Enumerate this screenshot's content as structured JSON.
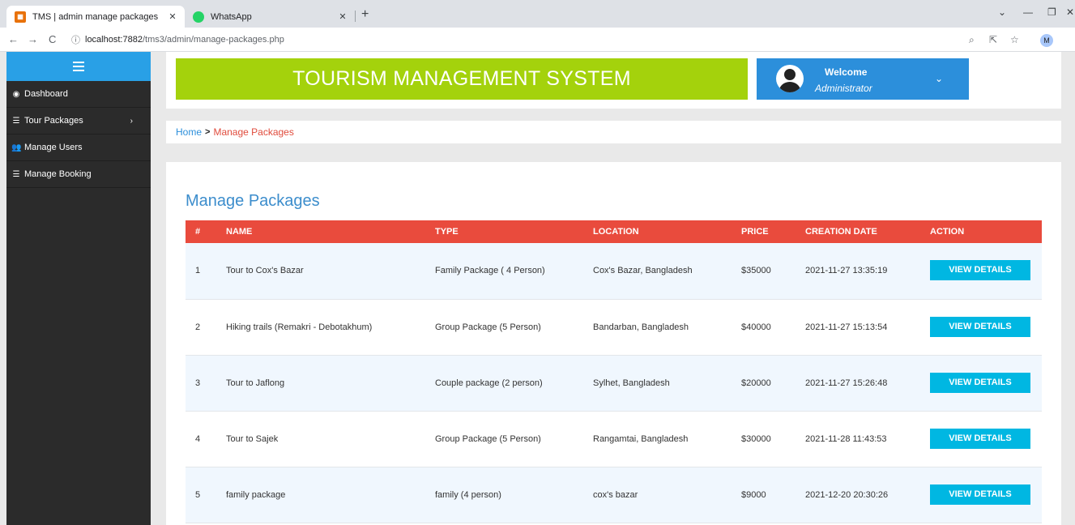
{
  "browser": {
    "tabs": [
      {
        "title": "TMS | admin manage packages",
        "close": "✕",
        "favicon": "tms-favicon"
      },
      {
        "title": "WhatsApp",
        "close": "✕",
        "favicon": "whatsapp-favicon"
      }
    ],
    "new_tab": "+",
    "window_controls": {
      "dropdown": "⌄",
      "minimize": "—",
      "restore": "❐",
      "close": "✕"
    },
    "nav": {
      "back": "←",
      "forward": "→",
      "reload": "C"
    },
    "url_host": "localhost:7882",
    "url_path": "/tms3/admin/manage-packages.php",
    "profile_initial": "M"
  },
  "sidebar": {
    "items": [
      {
        "label": "Dashboard",
        "icon": "dashboard-icon"
      },
      {
        "label": "Tour Packages",
        "icon": "list-icon"
      },
      {
        "label": "Manage Users",
        "icon": "users-icon"
      },
      {
        "label": "Manage Booking",
        "icon": "list-icon"
      }
    ]
  },
  "header": {
    "title": "TOURISM MANAGEMENT SYSTEM",
    "welcome": "Welcome",
    "user": "Administrator"
  },
  "breadcrumb": {
    "home": "Home",
    "separator": ">",
    "current": "Manage Packages"
  },
  "main": {
    "title": "Manage Packages",
    "columns": [
      "#",
      "NAME",
      "TYPE",
      "LOCATION",
      "PRICE",
      "CREATION DATE",
      "ACTION"
    ],
    "rows": [
      {
        "num": "1",
        "name": "Tour to Cox's Bazar",
        "type": "Family Package ( 4 Person)",
        "location": "Cox's Bazar, Bangladesh",
        "price": "$35000",
        "date": "2021-11-27 13:35:19",
        "action": "VIEW DETAILS"
      },
      {
        "num": "2",
        "name": "Hiking trails (Remakri - Debotakhum)",
        "type": "Group Package (5 Person)",
        "location": "Bandarban, Bangladesh",
        "price": "$40000",
        "date": "2021-11-27 15:13:54",
        "action": "VIEW DETAILS"
      },
      {
        "num": "3",
        "name": "Tour to Jaflong",
        "type": "Couple package (2 person)",
        "location": "Sylhet, Bangladesh",
        "price": "$20000",
        "date": "2021-11-27 15:26:48",
        "action": "VIEW DETAILS"
      },
      {
        "num": "4",
        "name": "Tour to Sajek",
        "type": "Group Package (5 Person)",
        "location": "Rangamtai, Bangladesh",
        "price": "$30000",
        "date": "2021-11-28 11:43:53",
        "action": "VIEW DETAILS"
      },
      {
        "num": "5",
        "name": "family package",
        "type": "family (4 person)",
        "location": "cox's bazar",
        "price": "$9000",
        "date": "2021-12-20 20:30:26",
        "action": "VIEW DETAILS"
      }
    ]
  },
  "colors": {
    "sidebar_bg": "#2b2b2b",
    "toggle_bg": "#29a0e6",
    "banner_bg": "#a4d20c",
    "welcome_bg": "#2c8fdb",
    "table_header_bg": "#e94b3d",
    "button_bg": "#00b7e2"
  }
}
